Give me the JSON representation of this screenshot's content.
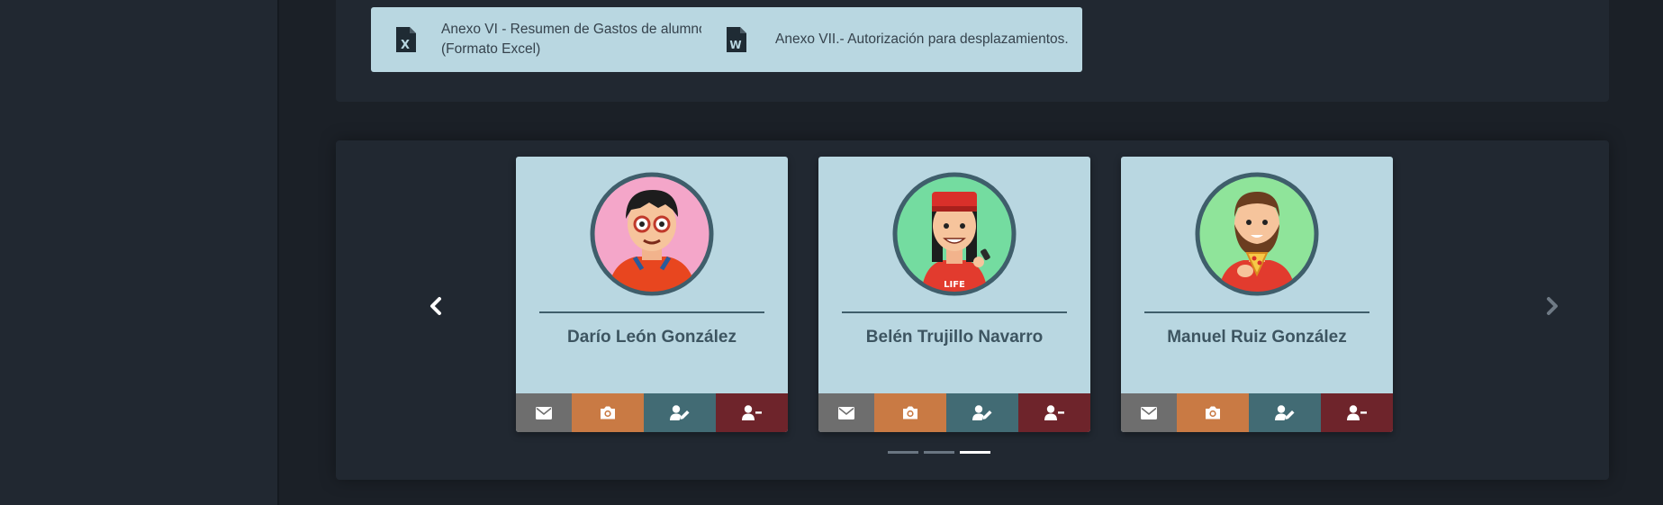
{
  "documents": [
    {
      "label": "Anexo VI - Resumen de Gastos de alumnos (Formato Excel)",
      "icon": "excel-file-icon",
      "icon_letter": "X"
    },
    {
      "label": "Anexo VII.- Autorización para desplazamientos.",
      "icon": "word-file-icon",
      "icon_letter": "W"
    }
  ],
  "carousel": {
    "prev_icon": "chevron-left-icon",
    "next_icon": "chevron-right-icon",
    "people": [
      {
        "name": "Darío León González",
        "avatar_bg": "#f4a6c9"
      },
      {
        "name": "Belén Trujillo Navarro",
        "avatar_bg": "#74dca0",
        "shirt_text": "LIFE"
      },
      {
        "name": "Manuel Ruiz González",
        "avatar_bg": "#8fe49a"
      }
    ],
    "actions": [
      {
        "name": "mail",
        "icon": "envelope-icon",
        "color": "#6e6e6e"
      },
      {
        "name": "photo",
        "icon": "camera-icon",
        "color": "#c97a44"
      },
      {
        "name": "edit",
        "icon": "user-edit-icon",
        "color": "#426b74"
      },
      {
        "name": "remove",
        "icon": "user-minus-icon",
        "color": "#6e242b"
      }
    ],
    "indicator_count": 3,
    "active_indicator": 3
  },
  "colors": {
    "card_bg": "#b9d7e1",
    "panel_bg": "#212831",
    "page_bg": "#1b2027"
  }
}
